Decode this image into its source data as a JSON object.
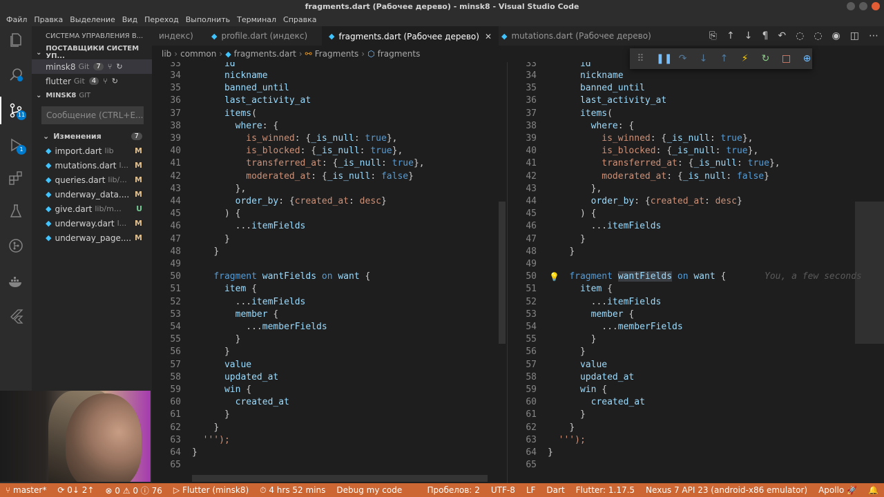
{
  "window": {
    "title": "fragments.dart (Рабочее дерево) - minsk8 - Visual Studio Code"
  },
  "menu": [
    "Файл",
    "Правка",
    "Выделение",
    "Вид",
    "Переход",
    "Выполнить",
    "Терминал",
    "Справка"
  ],
  "activity": {
    "scm_badge": "11",
    "debug_badge": "1"
  },
  "sidebar": {
    "header": "СИСТЕМА УПРАВЛЕНИЯ В...",
    "providers_title": "ПОСТАВЩИКИ СИСТЕМ УП...",
    "repos": [
      {
        "name": "minsk8",
        "vcs": "Git",
        "count": "7",
        "icon": "↻"
      },
      {
        "name": "flutter",
        "vcs": "Git",
        "count": "4",
        "icon": "↻"
      }
    ],
    "repo_section": "MINSK8",
    "repo_section_vcs": "GIT",
    "commit_placeholder": "Сообщение (CTRL+E...",
    "changes_label": "Изменения",
    "changes_count": "7",
    "files": [
      {
        "name": "import.dart",
        "path": "lib",
        "status": "M"
      },
      {
        "name": "mutations.dart",
        "path": "l...",
        "status": "M"
      },
      {
        "name": "queries.dart",
        "path": "lib/...",
        "status": "M"
      },
      {
        "name": "underway_data....",
        "path": "",
        "status": "M"
      },
      {
        "name": "give.dart",
        "path": "lib/mod...",
        "status": "U"
      },
      {
        "name": "underway.dart",
        "path": "l...",
        "status": "M"
      },
      {
        "name": "underway_page....",
        "path": "",
        "status": "M"
      }
    ]
  },
  "tabs": [
    {
      "label": "индекс)",
      "active": false
    },
    {
      "label": "profile.dart (индекс)",
      "active": false
    },
    {
      "label": "fragments.dart (Рабочее дерево)",
      "active": true
    },
    {
      "label": "mutations.dart (Рабочее дерево)",
      "active": false
    }
  ],
  "breadcrumb": [
    "lib",
    "common",
    "fragments.dart",
    "Fragments",
    "fragments"
  ],
  "editor": {
    "blame": "You, a few seconds"
  },
  "status": {
    "branch": "master*",
    "sync": "0↓ 2↑",
    "errors": "0",
    "warnings": "0",
    "infos": "76",
    "flutter_session": "Flutter (minsk8)",
    "time": "4 hrs 52 mins",
    "debug": "Debug my code",
    "spaces": "Пробелов: 2",
    "encoding": "UTF-8",
    "eol": "LF",
    "language": "Dart",
    "flutter_version": "Flutter: 1.17.5",
    "device": "Nexus 7 API 23 (android-x86 emulator)",
    "apollo": "Apollo"
  }
}
